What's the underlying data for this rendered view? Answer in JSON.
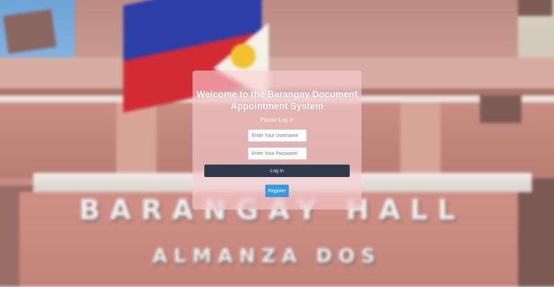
{
  "background": {
    "sign_line_1": "BARANGAY HALL",
    "sign_line_2": "ALMANZA DOS"
  },
  "login": {
    "title": "Welcome to the Barangay Document Appointment System",
    "subtitle": "Please Log In",
    "username_placeholder": "Enter Your Username",
    "password_placeholder": "Enter Your Password",
    "login_label": "Log In",
    "register_label": "Register"
  },
  "colors": {
    "card": "#f8ced4",
    "login_button": "#2f3a4a",
    "register_button": "#3a9ae0"
  }
}
